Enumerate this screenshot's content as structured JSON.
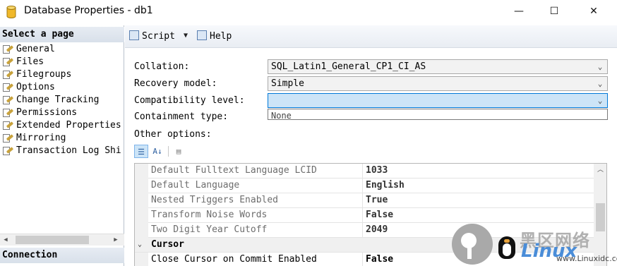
{
  "window": {
    "title": "Database Properties - db1",
    "minimize_glyph": "—",
    "maximize_glyph": "☐",
    "close_glyph": "✕"
  },
  "left_pane": {
    "select_page_heading": "Select a page",
    "pages": [
      {
        "label": "General",
        "icon": "page-wrench-icon"
      },
      {
        "label": "Files",
        "icon": "page-wrench-icon"
      },
      {
        "label": "Filegroups",
        "icon": "page-wrench-icon"
      },
      {
        "label": "Options",
        "icon": "page-wrench-icon"
      },
      {
        "label": "Change Tracking",
        "icon": "page-wrench-icon"
      },
      {
        "label": "Permissions",
        "icon": "page-wrench-icon"
      },
      {
        "label": "Extended Properties",
        "icon": "page-wrench-icon"
      },
      {
        "label": "Mirroring",
        "icon": "page-wrench-icon"
      },
      {
        "label": "Transaction Log Shi",
        "icon": "page-wrench-icon"
      }
    ],
    "connection_heading": "Connection"
  },
  "toolbar": {
    "script_label": "Script",
    "help_label": "Help"
  },
  "form": {
    "collation_label": "Collation:",
    "collation_value": "SQL_Latin1_General_CP1_CI_AS",
    "recovery_label": "Recovery model:",
    "recovery_value": "Simple",
    "compat_label": "Compatibility level:",
    "compat_value": "",
    "containment_label": "Containment type:",
    "containment_dropdown_partial": "None",
    "other_options_label": "Other options:"
  },
  "property_grid": {
    "rows": [
      {
        "name": "Default Fulltext Language LCID",
        "value": "1033",
        "kind": "readonly"
      },
      {
        "name": "Default Language",
        "value": "English",
        "kind": "readonly"
      },
      {
        "name": "Nested Triggers Enabled",
        "value": "True",
        "kind": "readonly"
      },
      {
        "name": "Transform Noise Words",
        "value": "False",
        "kind": "readonly"
      },
      {
        "name": "Two Digit Year Cutoff",
        "value": "2049",
        "kind": "readonly"
      },
      {
        "name": "Cursor",
        "value": "",
        "kind": "category"
      },
      {
        "name": "Close Cursor on Commit Enabled",
        "value": "False",
        "kind": "normal"
      }
    ]
  },
  "watermark": {
    "cn_text": "黑区网络",
    "brand_text": "Linux",
    "url_text": "www.Linuxidc.com"
  },
  "colors": {
    "accent_focus": "#cce4f7",
    "accent_border": "#0078d7",
    "section_header": "#dbe3ed"
  }
}
